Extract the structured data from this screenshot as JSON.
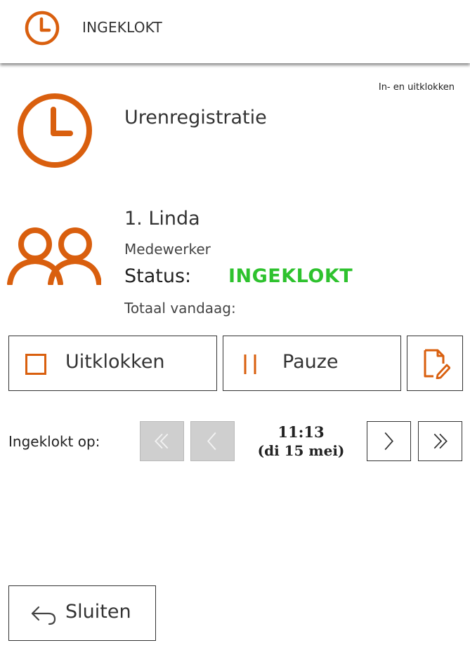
{
  "header": {
    "title": "INGEKLOKT",
    "icon": "clock-icon",
    "accent": "#d95f0e"
  },
  "breadcrumb": "In- en uitklokken",
  "app": {
    "title": "Urenregistratie",
    "icon": "clock-icon"
  },
  "employee": {
    "name": "1. Linda",
    "role": "Medewerker",
    "status_label": "Status:",
    "status_value": "INGEKLOKT",
    "status_color": "#2ec22e",
    "total_label": "Totaal vandaag:",
    "icon": "users-icon"
  },
  "actions": {
    "clock_out_label": "Uitklokken",
    "clock_out_icon": "square-icon",
    "pause_label": "Pauze",
    "pause_icon": "pause-icon",
    "edit_icon": "edit-note-icon"
  },
  "clocked_in": {
    "label": "Ingeklokt op:",
    "time": "11:13",
    "date": "(di 15 mei)",
    "nav": {
      "first_icon": "double-chevron-left-icon",
      "prev_icon": "chevron-left-icon",
      "next_icon": "chevron-right-icon",
      "last_icon": "double-chevron-right-icon"
    }
  },
  "footer": {
    "close_label": "Sluiten",
    "close_icon": "back-arrow-icon"
  }
}
